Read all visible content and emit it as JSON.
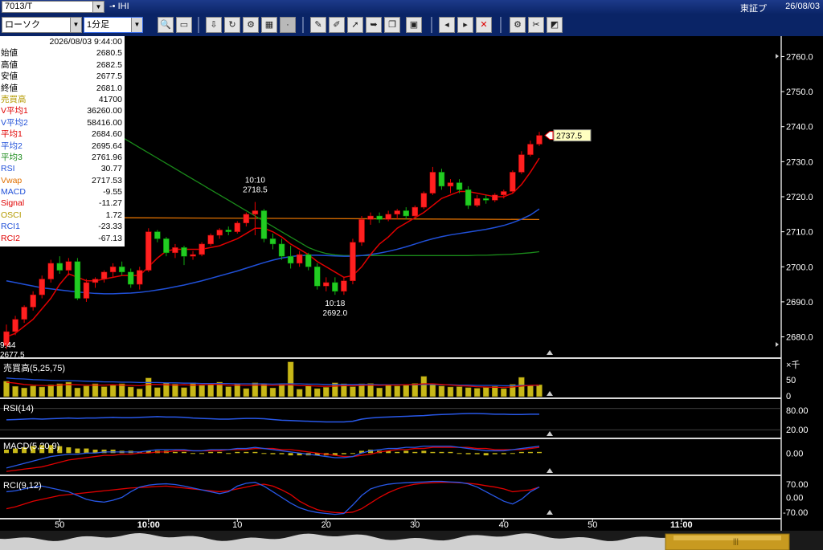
{
  "title_bar": {
    "code": "7013/T",
    "name": "-• IHI",
    "exchange": "東証プ",
    "date": "26/08/03"
  },
  "toolbar": {
    "chart_type": "ローソク",
    "interval": "1分足"
  },
  "info_panel": {
    "timestamp": "2026/08/03  9:44:00",
    "rows": [
      {
        "label": "始値",
        "value": "2680.5",
        "color": "#000000"
      },
      {
        "label": "高値",
        "value": "2682.5",
        "color": "#000000"
      },
      {
        "label": "安値",
        "value": "2677.5",
        "color": "#000000"
      },
      {
        "label": "終値",
        "value": "2681.0",
        "color": "#000000"
      },
      {
        "label": "売買高",
        "value": "41700",
        "color": "#b49a00"
      },
      {
        "label": "V平均1",
        "value": "36260.00",
        "color": "#e00000"
      },
      {
        "label": "V平均2",
        "value": "58416.00",
        "color": "#2050d8"
      },
      {
        "label": "平均1",
        "value": "2684.60",
        "color": "#e00000"
      },
      {
        "label": "平均2",
        "value": "2695.64",
        "color": "#2050d8"
      },
      {
        "label": "平均3",
        "value": "2761.96",
        "color": "#1a8a1a"
      },
      {
        "label": "RSI",
        "value": "30.77",
        "color": "#2050d8"
      },
      {
        "label": "Vwap",
        "value": "2717.53",
        "color": "#e07000"
      },
      {
        "label": "MACD",
        "value": "-9.55",
        "color": "#2050d8"
      },
      {
        "label": "Signal",
        "value": "-11.27",
        "color": "#e00000"
      },
      {
        "label": "OSCI",
        "value": "1.72",
        "color": "#b49a00"
      },
      {
        "label": "RCI1",
        "value": "-23.33",
        "color": "#2050d8"
      },
      {
        "label": "RCI2",
        "value": "-67.13",
        "color": "#e00000"
      }
    ]
  },
  "chart_data": [
    {
      "type": "candlestick",
      "candles": [
        [
          2677.5,
          2683.5,
          2676.5,
          2681.5
        ],
        [
          2681.5,
          2686,
          2680.5,
          2685
        ],
        [
          2685,
          2689,
          2684,
          2688.5
        ],
        [
          2688.5,
          2693,
          2687.5,
          2692
        ],
        [
          2692,
          2697.5,
          2691,
          2696.5
        ],
        [
          2696.5,
          2702,
          2695.5,
          2701
        ],
        [
          2701,
          2703,
          2698,
          2699
        ],
        [
          2699,
          2702.5,
          2697.5,
          2701.5
        ],
        [
          2701.5,
          2702.5,
          2690.5,
          2691
        ],
        [
          2691,
          2696.5,
          2690,
          2695.5
        ],
        [
          2695.5,
          2697,
          2694,
          2696.5
        ],
        [
          2696.5,
          2699,
          2695.5,
          2698.5
        ],
        [
          2698.5,
          2701,
          2697,
          2700
        ],
        [
          2700,
          2701.5,
          2697.5,
          2698.5
        ],
        [
          2698.5,
          2699.5,
          2694,
          2695
        ],
        [
          2695,
          2700,
          2693.5,
          2699
        ],
        [
          2699,
          2711,
          2698.5,
          2710
        ],
        [
          2710,
          2710.5,
          2707,
          2708
        ],
        [
          2708,
          2708.5,
          2703,
          2704
        ],
        [
          2704,
          2706.5,
          2702.5,
          2705.5
        ],
        [
          2705.5,
          2706,
          2700.5,
          2703
        ],
        [
          2703,
          2704.5,
          2702,
          2703.5
        ],
        [
          2703.5,
          2707,
          2703,
          2706.5
        ],
        [
          2706.5,
          2709.5,
          2706,
          2709
        ],
        [
          2709,
          2711,
          2708,
          2710.5
        ],
        [
          2710.5,
          2711.5,
          2709,
          2710
        ],
        [
          2710,
          2713,
          2709.5,
          2712.5
        ],
        [
          2712.5,
          2715.5,
          2711.5,
          2715
        ],
        [
          2715,
          2718.5,
          2709,
          2716
        ],
        [
          2716,
          2716.5,
          2707,
          2708
        ],
        [
          2708,
          2709.5,
          2705,
          2706.5
        ],
        [
          2706.5,
          2708,
          2702,
          2703
        ],
        [
          2703,
          2706,
          2699.5,
          2701
        ],
        [
          2701,
          2704.5,
          2700,
          2703.5
        ],
        [
          2703.5,
          2704,
          2699,
          2700
        ],
        [
          2700,
          2701,
          2693.5,
          2694.5
        ],
        [
          2694.5,
          2697,
          2693,
          2695.5
        ],
        [
          2695.5,
          2697,
          2692,
          2693
        ],
        [
          2693,
          2697,
          2692,
          2696
        ],
        [
          2696,
          2708,
          2695,
          2707
        ],
        [
          2707,
          2714.5,
          2706,
          2713.5
        ],
        [
          2713.5,
          2715.5,
          2712,
          2714.5
        ],
        [
          2714.5,
          2715.5,
          2712.5,
          2713.5
        ],
        [
          2713.5,
          2716,
          2713,
          2715
        ],
        [
          2715,
          2716.5,
          2713.5,
          2716
        ],
        [
          2716,
          2717,
          2713.5,
          2714.5
        ],
        [
          2714.5,
          2717.5,
          2714,
          2717
        ],
        [
          2717,
          2721.5,
          2716.5,
          2721
        ],
        [
          2721,
          2728.5,
          2720.5,
          2727
        ],
        [
          2727,
          2728,
          2722,
          2723
        ],
        [
          2723,
          2725,
          2721,
          2724
        ],
        [
          2724,
          2725,
          2721,
          2722
        ],
        [
          2722,
          2723,
          2716.5,
          2717.5
        ],
        [
          2717.5,
          2720.5,
          2717,
          2719.5
        ],
        [
          2719.5,
          2720.5,
          2718,
          2719
        ],
        [
          2719,
          2721,
          2718.5,
          2720.5
        ],
        [
          2720.5,
          2722,
          2719.5,
          2721.5
        ],
        [
          2721.5,
          2727.5,
          2721,
          2727
        ],
        [
          2727,
          2733,
          2726.5,
          2732
        ],
        [
          2732,
          2736,
          2731.5,
          2735
        ],
        [
          2735,
          2738.5,
          2734.5,
          2737.5
        ]
      ],
      "ma1": [
        2680,
        2681,
        2683,
        2685,
        2688,
        2691,
        2695,
        2698,
        2697,
        2696,
        2696,
        2696.5,
        2697,
        2697.5,
        2697.5,
        2697.5,
        2700,
        2702.5,
        2704.5,
        2705,
        2705,
        2705,
        2705,
        2705.5,
        2706,
        2707,
        2708,
        2709.5,
        2711,
        2711,
        2710,
        2708.5,
        2706.5,
        2705,
        2703.5,
        2701.5,
        2700,
        2698.5,
        2697,
        2697.5,
        2700,
        2703.5,
        2706.5,
        2708.5,
        2711,
        2712.5,
        2714,
        2715.5,
        2717.5,
        2719.5,
        2720.5,
        2721.5,
        2721.5,
        2721,
        2720.5,
        2720,
        2720,
        2721,
        2723.5,
        2727,
        2731
      ],
      "ma2": [
        2696,
        2695.5,
        2695,
        2694.5,
        2694,
        2693.7,
        2693.4,
        2693.1,
        2692.8,
        2692.6,
        2692.4,
        2692.3,
        2692.3,
        2692.4,
        2692.5,
        2692.7,
        2693,
        2693.4,
        2693.8,
        2694.3,
        2694.8,
        2695.4,
        2696,
        2696.7,
        2697.4,
        2698.1,
        2698.8,
        2699.6,
        2700.4,
        2701.2,
        2701.9,
        2702.5,
        2702.9,
        2703.2,
        2703.3,
        2703.3,
        2703.2,
        2703.1,
        2703,
        2703,
        2703.2,
        2703.5,
        2703.9,
        2704.4,
        2705,
        2705.7,
        2706.5,
        2707.3,
        2708,
        2708.6,
        2709.1,
        2709.5,
        2709.9,
        2710.3,
        2710.7,
        2711.2,
        2711.8,
        2712.6,
        2713.6,
        2714.8,
        2716.5
      ],
      "ma3": {
        "start_index": 13,
        "values": [
          2737,
          2735.5,
          2734,
          2732.5,
          2731,
          2729.5,
          2728,
          2726.5,
          2725,
          2723.5,
          2722,
          2720.5,
          2719,
          2717.5,
          2716,
          2714.5,
          2713,
          2711.5,
          2710,
          2708.5,
          2707,
          2705.5,
          2704.5,
          2703.8,
          2703.4,
          2703.2,
          2703.2,
          2703.2,
          2703.2,
          2703.2,
          2703.2,
          2703.2,
          2703.2,
          2703.2,
          2703.2,
          2703.2,
          2703.2,
          2703.2,
          2703.2,
          2703.2,
          2703.3,
          2703.3,
          2703.4,
          2703.5,
          2703.6,
          2703.8,
          2704,
          2704.3
        ]
      },
      "vwap_start": 2714,
      "vwap_end": 2713.5,
      "yaxis": {
        "min": 2676,
        "max": 2764,
        "ticks": [
          2680.0,
          2690.0,
          2700.0,
          2710.0,
          2720.0,
          2730.0,
          2740.0,
          2750.0,
          2760.0
        ]
      },
      "annotations": [
        {
          "index": 28,
          "time": "10:10",
          "price": "2718.5"
        },
        {
          "index": 37,
          "time": "10:18",
          "price": "2692.0"
        },
        {
          "index": 0,
          "time": "9:44",
          "price": "2677.5"
        }
      ],
      "last_price": "2737.5"
    },
    {
      "type": "bar",
      "title": "売買高(5,25,75)",
      "values": [
        48,
        32,
        27,
        33,
        30,
        37,
        40,
        45,
        27,
        33,
        40,
        31,
        35,
        40,
        30,
        24,
        58,
        28,
        42,
        39,
        28,
        43,
        35,
        37,
        45,
        31,
        40,
        25,
        43,
        40,
        27,
        38,
        45,
        23,
        35,
        25,
        29,
        43,
        40,
        31,
        40,
        41,
        27,
        38,
        33,
        35,
        41,
        63,
        38,
        33,
        30,
        31,
        28,
        26,
        28,
        32,
        25,
        38,
        60,
        35,
        37
      ],
      "spike": {
        "index": 32,
        "value": 108
      },
      "ma1": [
        45,
        42,
        38,
        36,
        35,
        34,
        36,
        38,
        37,
        36,
        36,
        36,
        37,
        36,
        35,
        34,
        38,
        38,
        37,
        36,
        37,
        36,
        37,
        38,
        38,
        36,
        36,
        35,
        36,
        36,
        35,
        36,
        37,
        34,
        34,
        33,
        32,
        33,
        34,
        34,
        35,
        36,
        35,
        36,
        36,
        37,
        38,
        40,
        40,
        38,
        36,
        34,
        33,
        31,
        30,
        29,
        29,
        30,
        33,
        35,
        36
      ],
      "ma2": [
        58,
        56,
        55,
        53,
        52,
        51,
        50,
        50,
        49,
        48,
        47,
        46,
        46,
        45,
        45,
        44,
        44,
        44,
        43,
        43,
        42,
        42,
        41,
        41,
        41,
        41,
        40,
        40,
        40,
        40,
        39,
        40,
        40,
        40,
        39,
        39,
        38,
        38,
        38,
        38,
        38,
        38,
        37,
        37,
        37,
        37,
        37,
        38,
        38,
        37,
        37,
        36,
        36,
        35,
        35,
        35,
        34,
        34,
        35,
        35,
        35
      ],
      "ylabels": [
        "×千",
        "50",
        "0"
      ],
      "ymax": 110
    },
    {
      "type": "line",
      "title": "RSI(14)",
      "values": [
        48,
        49,
        50,
        51,
        50,
        51,
        52,
        53,
        52,
        53,
        53,
        54,
        55,
        54,
        54,
        55,
        56,
        57,
        56,
        56,
        55,
        53,
        52,
        51,
        50,
        50,
        51,
        52,
        52,
        51,
        49,
        47,
        46,
        45,
        44,
        43,
        42,
        42,
        42,
        44,
        50,
        53,
        55,
        56,
        57,
        58,
        59,
        60,
        62,
        63,
        64,
        65,
        66,
        66,
        65,
        64,
        64,
        63,
        63,
        64,
        64
      ],
      "ylabels": [
        "80.00",
        "20.00"
      ],
      "ymin": 0,
      "ymax": 100
    },
    {
      "type": "macd",
      "title": "MACD(5,20,9)",
      "macd": [
        -13,
        -11,
        -9,
        -7,
        -5,
        -3,
        -2,
        -1,
        -1,
        0,
        0,
        1,
        1,
        1,
        1,
        1,
        2,
        3,
        3,
        3,
        3,
        2,
        2,
        3,
        3,
        3,
        4,
        4,
        5,
        4,
        3,
        2,
        1,
        0,
        -1,
        -2,
        -3,
        -4,
        -4,
        -3,
        0,
        2,
        3,
        4,
        4,
        5,
        5,
        6,
        6,
        6,
        6,
        5,
        4,
        3,
        2,
        2,
        2,
        3,
        4,
        5,
        6
      ],
      "signal": [
        -16,
        -15,
        -14,
        -13,
        -12,
        -10,
        -8,
        -6,
        -5,
        -4,
        -3,
        -2,
        -2,
        -1,
        -1,
        0,
        0,
        1,
        1,
        2,
        2,
        2,
        2,
        2,
        2,
        3,
        3,
        3,
        4,
        4,
        4,
        3,
        3,
        2,
        1,
        0,
        -1,
        -2,
        -3,
        -3,
        -2,
        -1,
        1,
        2,
        3,
        3,
        4,
        4,
        5,
        5,
        5,
        5,
        5,
        4,
        4,
        3,
        3,
        3,
        3,
        4,
        5
      ],
      "osci": [
        3,
        4,
        5,
        6,
        7,
        7,
        6,
        5,
        4,
        4,
        3,
        3,
        3,
        2,
        2,
        1,
        2,
        2,
        2,
        1,
        1,
        0,
        0,
        1,
        1,
        0,
        1,
        1,
        1,
        0,
        -1,
        -1,
        -2,
        -2,
        -2,
        -2,
        -2,
        -2,
        -1,
        0,
        2,
        3,
        2,
        2,
        1,
        2,
        1,
        2,
        1,
        1,
        1,
        0,
        -1,
        -1,
        -2,
        -1,
        -1,
        0,
        1,
        1,
        1
      ],
      "ylabel": "0.00",
      "ymin": -18,
      "ymax": 10
    },
    {
      "type": "line",
      "title": "RCI(9,12)",
      "rci1": [
        30,
        35,
        45,
        55,
        60,
        50,
        40,
        30,
        10,
        -10,
        -20,
        -25,
        -15,
        0,
        30,
        55,
        65,
        70,
        72,
        68,
        60,
        50,
        40,
        30,
        20,
        30,
        60,
        75,
        80,
        60,
        30,
        0,
        -30,
        -55,
        -70,
        -80,
        -85,
        -90,
        -85,
        -40,
        10,
        45,
        60,
        70,
        75,
        78,
        80,
        82,
        85,
        85,
        82,
        80,
        72,
        55,
        30,
        5,
        -20,
        -35,
        -10,
        30,
        55
      ],
      "rci2": [
        -60,
        -50,
        -35,
        -20,
        -10,
        0,
        10,
        15,
        20,
        25,
        30,
        35,
        40,
        45,
        50,
        52,
        55,
        58,
        60,
        55,
        50,
        45,
        40,
        35,
        30,
        35,
        45,
        55,
        65,
        70,
        60,
        40,
        15,
        -20,
        -45,
        -65,
        -75,
        -80,
        -82,
        -78,
        -60,
        -30,
        0,
        25,
        45,
        60,
        70,
        75,
        78,
        80,
        80,
        78,
        75,
        70,
        62,
        55,
        45,
        30,
        35,
        40,
        55
      ],
      "ylabels": [
        "70.00",
        "0.00",
        "-70.00"
      ],
      "ymin": -100,
      "ymax": 100
    },
    {
      "type": "axis",
      "xlabels": [
        "50",
        "10:00",
        "10",
        "20",
        "30",
        "40",
        "50",
        "11:00"
      ]
    }
  ]
}
